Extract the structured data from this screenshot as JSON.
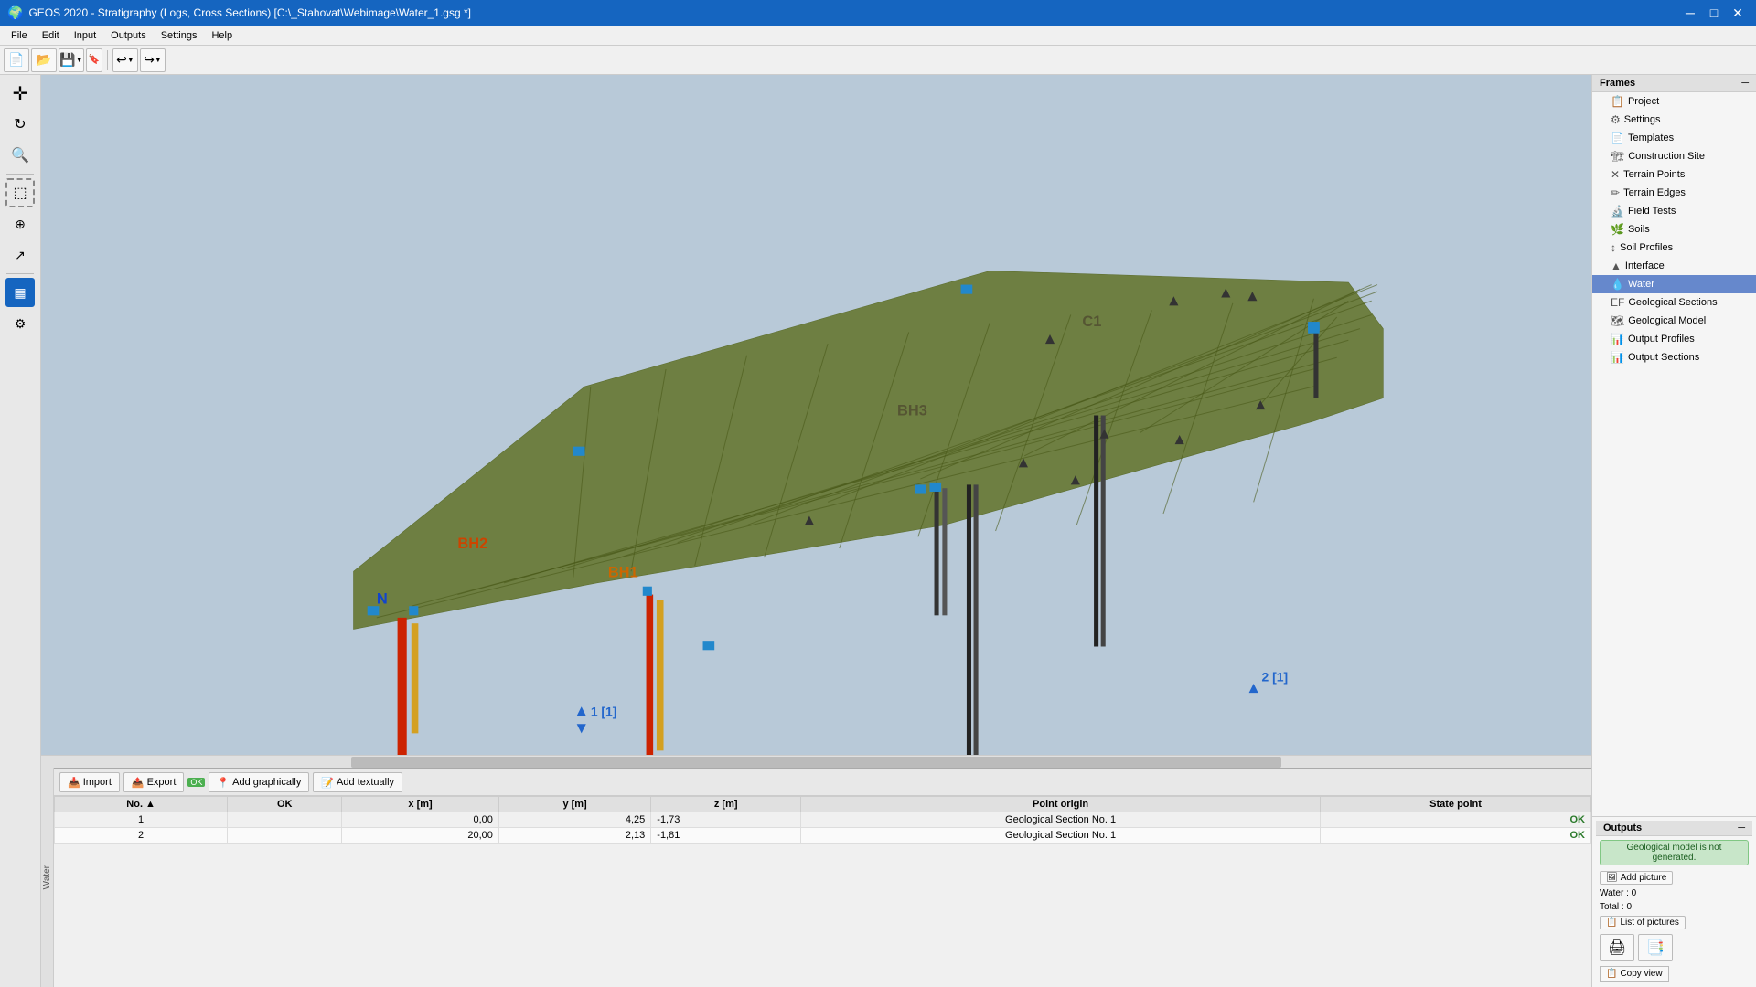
{
  "titleBar": {
    "title": "GEOS 2020 - Stratigraphy (Logs, Cross Sections) [C:\\_Stahovat\\Webimage\\Water_1.gsg *]",
    "minimize": "─",
    "maximize": "□",
    "close": "✕"
  },
  "menuBar": {
    "items": [
      "File",
      "Edit",
      "Input",
      "Outputs",
      "Settings",
      "Help"
    ]
  },
  "toolbar": {
    "new_label": "📄",
    "open_label": "📂",
    "save_label": "💾",
    "bookmark_label": "🔖",
    "undo_label": "↩",
    "redo_label": "↪"
  },
  "leftTools": [
    {
      "name": "move",
      "icon": "✛"
    },
    {
      "name": "rotate",
      "icon": "↻"
    },
    {
      "name": "zoom",
      "icon": "🔍"
    },
    {
      "name": "select-rect",
      "icon": "⬚"
    },
    {
      "name": "node",
      "icon": "⊕"
    },
    {
      "name": "measure",
      "icon": "📐"
    },
    {
      "name": "table-view",
      "icon": "▦",
      "active": true
    },
    {
      "name": "settings-tool",
      "icon": "⚙"
    }
  ],
  "frames": {
    "header": "Frames",
    "collapse": "─",
    "items": [
      {
        "id": "project",
        "label": "Project",
        "icon": "📋"
      },
      {
        "id": "settings",
        "label": "Settings",
        "icon": "⚙"
      },
      {
        "id": "templates",
        "label": "Templates",
        "icon": "📄"
      },
      {
        "id": "construction-site",
        "label": "Construction Site",
        "icon": "🏗"
      },
      {
        "id": "terrain-points",
        "label": "Terrain Points",
        "icon": "✕"
      },
      {
        "id": "terrain-edges",
        "label": "Terrain Edges",
        "icon": "✏"
      },
      {
        "id": "field-tests",
        "label": "Field Tests",
        "icon": "🔬"
      },
      {
        "id": "soils",
        "label": "Soils",
        "icon": "🌿"
      },
      {
        "id": "soil-profiles",
        "label": "Soil Profiles",
        "icon": "↕"
      },
      {
        "id": "interface",
        "label": "Interface",
        "icon": "▲"
      },
      {
        "id": "water",
        "label": "Water",
        "icon": "💧",
        "selected": true
      },
      {
        "id": "geological-sections",
        "label": "Geological Sections",
        "icon": "EF"
      },
      {
        "id": "geological-model",
        "label": "Geological Model",
        "icon": "🗺"
      },
      {
        "id": "output-profiles",
        "label": "Output Profiles",
        "icon": "📊"
      },
      {
        "id": "output-sections",
        "label": "Output Sections",
        "icon": "📊"
      }
    ]
  },
  "bottomPanel": {
    "import_label": "Import",
    "export_label": "Export",
    "ok_badge": "OK",
    "add_graphically_label": "Add graphically",
    "add_textually_label": "Add textually",
    "table": {
      "columns": [
        "No.",
        "OK",
        "x [m]",
        "y [m]",
        "z [m]",
        "Point origin",
        "State point"
      ],
      "rows": [
        {
          "no": "1",
          "ok": "",
          "x": "0,00",
          "y": "4,25",
          "z": "-1,73",
          "origin": "Geological Section No. 1",
          "state": "OK"
        },
        {
          "no": "2",
          "ok": "",
          "x": "20,00",
          "y": "2,13",
          "z": "-1,81",
          "origin": "Geological Section No. 1",
          "state": "OK"
        }
      ]
    }
  },
  "sideLabel": "Water",
  "outputs": {
    "header": "Outputs",
    "collapse": "─",
    "geological_model_status": "Geological model is not generated.",
    "add_picture_label": "Add picture",
    "water_label": "Water :",
    "water_value": "0",
    "total_label": "Total :",
    "total_value": "0",
    "list_of_pictures_label": "List of pictures",
    "copy_view_label": "Copy view"
  },
  "scene": {
    "borehole_labels": [
      "BH1",
      "BH2",
      "BH3",
      "C1",
      "N"
    ],
    "point_labels": [
      "1 [1]",
      "2 [1]"
    ]
  }
}
